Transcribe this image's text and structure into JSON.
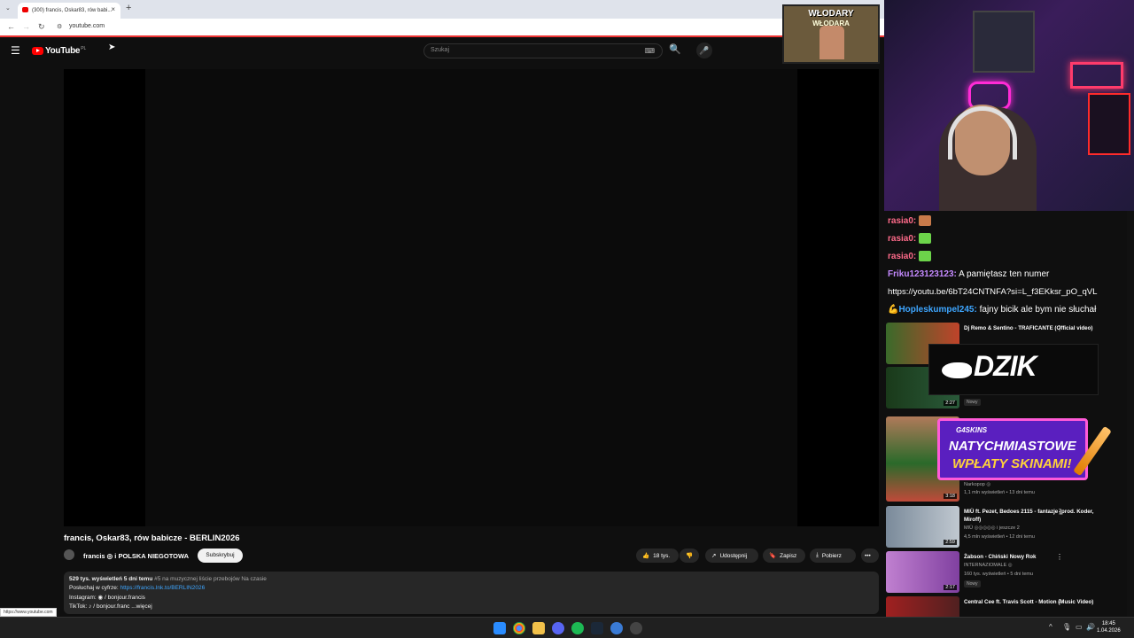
{
  "browser": {
    "tab_title": "(300) francis, Oskar83, rów babi...",
    "tab_close": "×",
    "new_tab": "+",
    "tab_dropdown": "⌄",
    "url": "youtube.com",
    "back": "←",
    "forward": "→",
    "reload": "↻",
    "site_info": "⚙",
    "status_url": "https://www.youtube.com"
  },
  "youtube": {
    "menu_icon": "☰",
    "logo_text": "YouTube",
    "logo_region": "PL",
    "search_placeholder": "Szukaj",
    "keyboard_icon": "⌨",
    "search_icon": "🔍",
    "mic_icon": "🎤"
  },
  "video": {
    "title": "francis, Oskar83, rów babicze - BERLIN2026",
    "channel": "francis ◎ i POLSKA NIEGOTOWA",
    "subscribe": "Subskrybuj",
    "likes": "18 tys.",
    "like_icon": "👍",
    "dislike_icon": "👎",
    "share": "Udostępnij",
    "share_icon": "↗",
    "save": "Zapisz",
    "save_icon": "🔖",
    "download": "Pobierz",
    "download_icon": "⤓",
    "more": "•••"
  },
  "description": {
    "stats": "529 tys. wyświetleń  5 dni temu",
    "tags": "#5 na muzycznej liście przebojów Na czasie",
    "listen_label": "Posłuchaj w cyfrze:",
    "listen_link": "https://francis.lnk.to/BERLIN2026",
    "instagram_label": "Instagram:",
    "instagram_value": "◉ / bonjour.francis",
    "tiktok_label": "TikTok:",
    "tiktok_value": "♪ / bonjour.franc",
    "more_label": "...więcej"
  },
  "overlay": {
    "title_line1": "WŁODARY",
    "title_line2": "WŁODARA"
  },
  "chat": [
    {
      "user": "rasia0:",
      "text": "",
      "emote": "brown"
    },
    {
      "user": "rasia0:",
      "text": "",
      "emote": "green"
    },
    {
      "user": "rasia0:",
      "text": "",
      "emote": "green"
    },
    {
      "user": "Friku123123123:",
      "text": "A pamiętasz ten numer"
    },
    {
      "user": "",
      "text": "https://youtu.be/6bT24CNTNFA?si=L_f3EKksr_pO_qVL"
    },
    {
      "user": "Hopleskumpel245:",
      "text": "fajny bicik ale bym nie słuchał",
      "prefix": "💪"
    }
  ],
  "recommendations": [
    {
      "title": "Dj Remo & Sentino - TRAFICANTE (Official video)",
      "channel": "",
      "meta": "",
      "duration": "",
      "badge": ""
    },
    {
      "title": "",
      "channel": "",
      "meta": "",
      "duration": "2:27",
      "badge": "Nowy"
    },
    {
      "title": "",
      "channel": "Narkopop ◎",
      "meta": "1,1 mln wyświetleń • 13 dni temu",
      "duration": "3:18",
      "badge": ""
    },
    {
      "title": "MIÜ ft. Pezet, Bedoes 2115 - fantazje (prod. Koder, Miroff)",
      "channel": "MIÜ ◎◎◎◎◎ i jeszcze 2",
      "meta": "4,5 mln wyświetleń • 12 dni temu",
      "duration": "2:59",
      "badge": ""
    },
    {
      "title": "Żabson - Chiński Nowy Rok",
      "channel": "INTERNAZIOMALE ◎",
      "meta": "160 tys. wyświetleń • 5 dni temu",
      "duration": "2:17",
      "badge": "Nowy"
    },
    {
      "title": "Central Cee ft. Travis Scott - Motion (Music Video)",
      "channel": "",
      "meta": "",
      "duration": "",
      "badge": ""
    }
  ],
  "ads": {
    "dzik": "DZIK",
    "promo_brand": "G4SKINS",
    "promo_line1": "NATYCHMIASTOWE",
    "promo_line2": "WPŁATY SKINAMI!"
  },
  "taskbar": {
    "time": "18:45",
    "date": "1.04.2026",
    "tray_up": "^",
    "tray_mic": "🎙",
    "tray_display": "▭",
    "tray_volume": "🔊"
  },
  "colors": {
    "bg": "#0f0f0f",
    "accent": "#ff0000",
    "link": "#3ea6ff"
  }
}
